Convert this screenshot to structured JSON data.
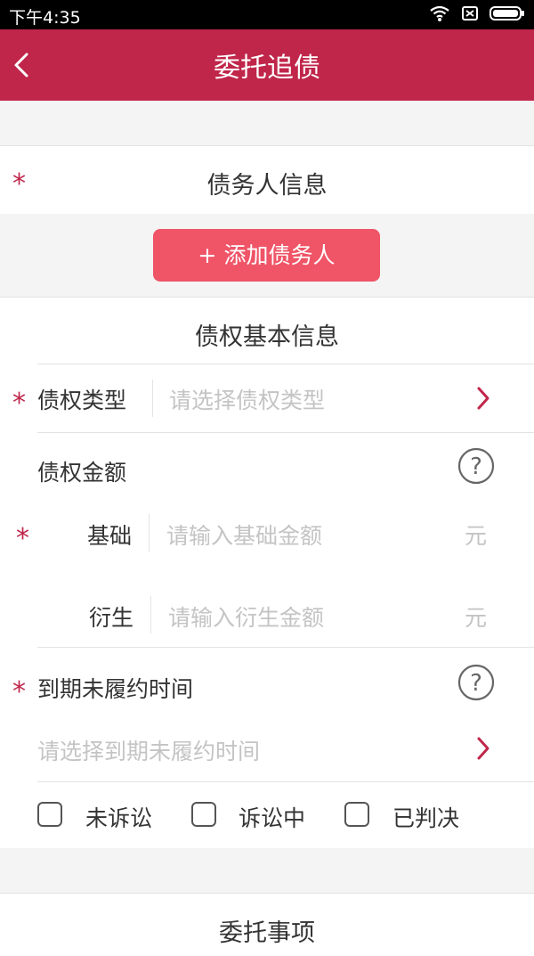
{
  "status_bar": {
    "time": "下午4:35"
  },
  "app_bar": {
    "title": "委托追债"
  },
  "debtor_section": {
    "title": "债务人信息",
    "add_button": "+ 添加债务人"
  },
  "claim_section": {
    "title": "债权基本信息",
    "claim_type": {
      "label": "债权类型",
      "placeholder": "请选择债权类型"
    },
    "claim_amount": {
      "label": "债权金额",
      "base": {
        "label": "基础",
        "placeholder": "请输入基础金额",
        "unit": "元"
      },
      "derived": {
        "label": "衍生",
        "placeholder": "请输入衍生金额",
        "unit": "元"
      }
    },
    "due_time": {
      "label": "到期未履约时间",
      "placeholder": "请选择到期未履约时间"
    },
    "litigation_options": [
      {
        "label": "未诉讼",
        "checked": false
      },
      {
        "label": "诉讼中",
        "checked": false
      },
      {
        "label": "已判决",
        "checked": false
      }
    ]
  },
  "entrust_section": {
    "title": "委托事项"
  },
  "colors": {
    "brand": "#c0264a",
    "button": "#ef5467",
    "placeholder": "#c4c4c4"
  }
}
